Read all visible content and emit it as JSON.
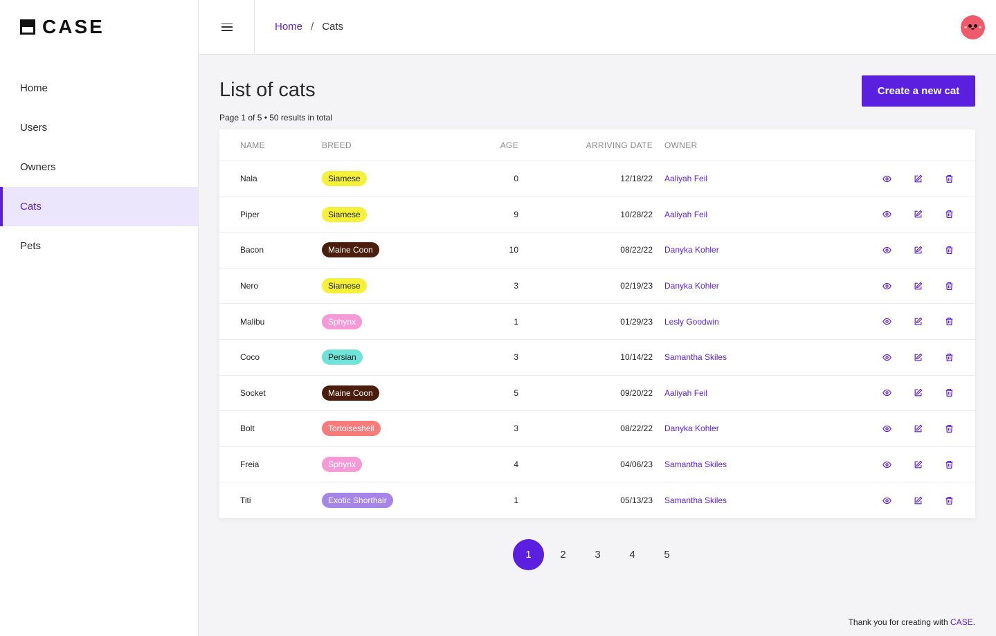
{
  "app": {
    "brand": "CASE"
  },
  "sidebar": {
    "items": [
      {
        "label": "Home",
        "active": false
      },
      {
        "label": "Users",
        "active": false
      },
      {
        "label": "Owners",
        "active": false
      },
      {
        "label": "Cats",
        "active": true
      },
      {
        "label": "Pets",
        "active": false
      }
    ]
  },
  "breadcrumb": {
    "home": "Home",
    "separator": "/",
    "current": "Cats"
  },
  "main": {
    "title": "List of cats",
    "meta": "Page 1 of 5 • 50 results in total",
    "create_button": "Create a new cat"
  },
  "table": {
    "headers": {
      "name": "NAME",
      "breed": "BREED",
      "age": "AGE",
      "date": "ARRIVING DATE",
      "owner": "OWNER"
    },
    "rows": [
      {
        "name": "Nala",
        "breed": "Siamese",
        "breed_bg": "#f5f03a",
        "breed_fg": "#222222",
        "age": "0",
        "date": "12/18/22",
        "owner": "Aaliyah Feil"
      },
      {
        "name": "Piper",
        "breed": "Siamese",
        "breed_bg": "#f5f03a",
        "breed_fg": "#222222",
        "age": "9",
        "date": "10/28/22",
        "owner": "Aaliyah Feil"
      },
      {
        "name": "Bacon",
        "breed": "Maine Coon",
        "breed_bg": "#4a1d0c",
        "breed_fg": "#ffffff",
        "age": "10",
        "date": "08/22/22",
        "owner": "Danyka Kohler"
      },
      {
        "name": "Nero",
        "breed": "Siamese",
        "breed_bg": "#f5f03a",
        "breed_fg": "#222222",
        "age": "3",
        "date": "02/19/23",
        "owner": "Danyka Kohler"
      },
      {
        "name": "Malibu",
        "breed": "Sphynx",
        "breed_bg": "#f59ad6",
        "breed_fg": "#ffffff",
        "age": "1",
        "date": "01/29/23",
        "owner": "Lesly Goodwin"
      },
      {
        "name": "Coco",
        "breed": "Persian",
        "breed_bg": "#6fe3d7",
        "breed_fg": "#222222",
        "age": "3",
        "date": "10/14/22",
        "owner": "Samantha Skiles"
      },
      {
        "name": "Socket",
        "breed": "Maine Coon",
        "breed_bg": "#4a1d0c",
        "breed_fg": "#ffffff",
        "age": "5",
        "date": "09/20/22",
        "owner": "Aaliyah Feil"
      },
      {
        "name": "Bolt",
        "breed": "Tortoiseshell",
        "breed_bg": "#f87b7b",
        "breed_fg": "#ffffff",
        "age": "3",
        "date": "08/22/22",
        "owner": "Danyka Kohler"
      },
      {
        "name": "Freia",
        "breed": "Sphynx",
        "breed_bg": "#f59ad6",
        "breed_fg": "#ffffff",
        "age": "4",
        "date": "04/06/23",
        "owner": "Samantha Skiles"
      },
      {
        "name": "Titi",
        "breed": "Exotic Shorthair",
        "breed_bg": "#a585e8",
        "breed_fg": "#ffffff",
        "age": "1",
        "date": "05/13/23",
        "owner": "Samantha Skiles"
      }
    ],
    "actions": [
      "eye-icon",
      "edit-icon",
      "trash-icon"
    ]
  },
  "pagination": {
    "pages": [
      "1",
      "2",
      "3",
      "4",
      "5"
    ],
    "current": "1"
  },
  "footer": {
    "text": "Thank you for creating with ",
    "link": "CASE",
    "suffix": "."
  },
  "colors": {
    "accent": "#5b1fe0",
    "active_bg": "#ece6fc",
    "avatar": "#ef5b6b"
  }
}
